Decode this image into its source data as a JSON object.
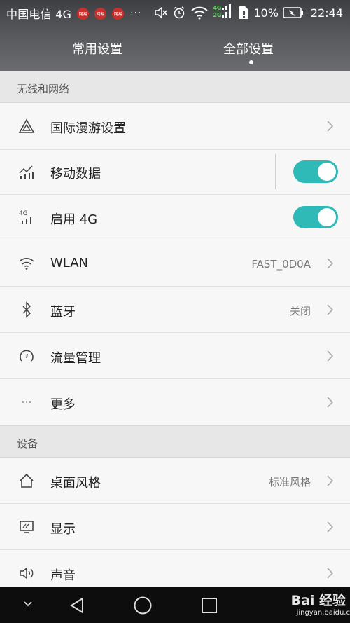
{
  "status_bar": {
    "carrier": "中国电信 4G",
    "notif_text": "网易",
    "dots": "···",
    "net_top": "4G",
    "net_bottom": "2G",
    "battery": "10%",
    "time": "22:44"
  },
  "tabs": {
    "common": "常用设置",
    "all": "全部设置",
    "active": "all"
  },
  "sections": {
    "wireless": "无线和网络",
    "device": "设备"
  },
  "rows": {
    "roaming": {
      "label": "国际漫游设置",
      "icon": "roaming-triangle-icon"
    },
    "mobile_data": {
      "label": "移动数据",
      "icon": "mobile-data-icon",
      "toggle": true
    },
    "enable_4g": {
      "label": "启用 4G",
      "icon": "signal-4g-icon",
      "icon_text": "4G",
      "toggle": true
    },
    "wlan": {
      "label": "WLAN",
      "value": "FAST_0D0A",
      "icon": "wifi-icon"
    },
    "bluetooth": {
      "label": "蓝牙",
      "value": "关闭",
      "icon": "bluetooth-icon"
    },
    "traffic": {
      "label": "流量管理",
      "icon": "gauge-icon"
    },
    "more": {
      "label": "更多",
      "icon": "more-dots-icon",
      "icon_text": "···"
    },
    "desktop": {
      "label": "桌面风格",
      "value": "标准风格",
      "icon": "home-icon"
    },
    "display": {
      "label": "显示",
      "icon": "display-icon"
    },
    "sound": {
      "label": "声音",
      "icon": "speaker-icon"
    }
  },
  "colors": {
    "accent": "#2fbab7",
    "header": "#4a4c4f",
    "section_bg": "#e7e7e7"
  },
  "watermark": {
    "brand": "Bai 经验",
    "url": "jingyan.baidu.com"
  }
}
